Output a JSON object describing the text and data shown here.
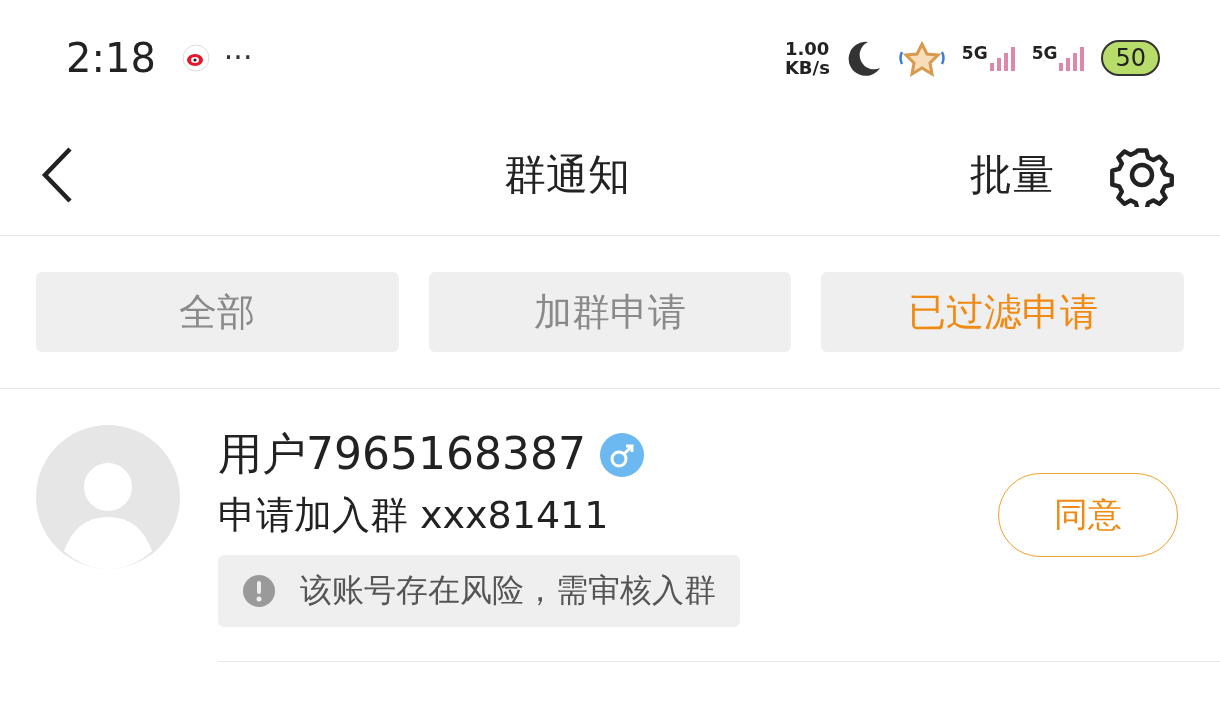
{
  "status_bar": {
    "time": "2:18",
    "more": "···",
    "speed_value": "1.00",
    "speed_unit": "KB/s",
    "signal_1": "5G",
    "signal_2": "5G",
    "battery": "50"
  },
  "nav": {
    "title": "群通知",
    "action": "批量"
  },
  "tabs": [
    {
      "label": "全部",
      "selected": false
    },
    {
      "label": "加群申请",
      "selected": false
    },
    {
      "label": "已过滤申请",
      "selected": true
    }
  ],
  "requests": [
    {
      "name": "用户7965168387",
      "male": true,
      "message": "申请加入群 xxx81411",
      "warning": "该账号存在风险，需审核入群",
      "button": "同意"
    }
  ]
}
